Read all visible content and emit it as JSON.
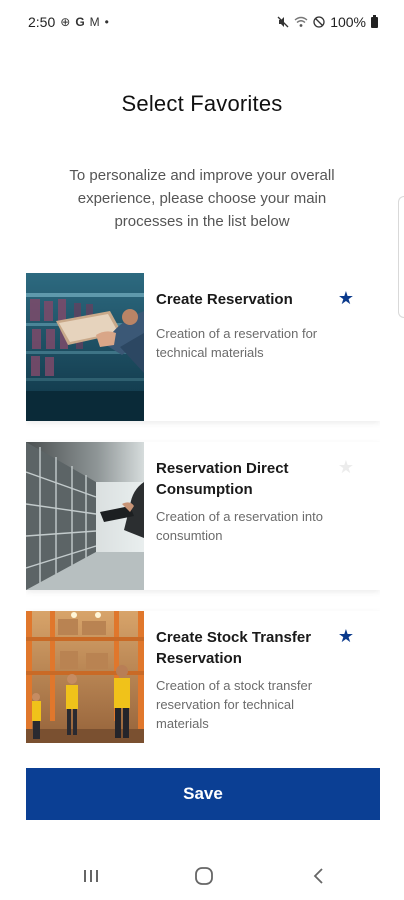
{
  "status_bar": {
    "time": "2:50",
    "battery": "100%"
  },
  "header": {
    "title": "Select Favorites"
  },
  "intro": {
    "text": "To personalize and improve your overall experience, please choose your main processes in the list below"
  },
  "processes": [
    {
      "title": "Create Reservation",
      "description": "Creation of a reservation for technical materials",
      "favorite": true,
      "image": "warehouse-tablet-photo"
    },
    {
      "title": "Reservation Direct Consumption",
      "description": "Creation of a reservation into consumtion",
      "favorite": false,
      "image": "warehouse-aisle-photo"
    },
    {
      "title": "Create Stock Transfer Reservation",
      "description": "Creation of a stock transfer reservation for technical materials",
      "favorite": true,
      "image": "warehouse-workers-photo"
    }
  ],
  "actions": {
    "save_label": "Save"
  },
  "colors": {
    "primary": "#0b3f94",
    "star_active": "#0b3a8c",
    "star_inactive": "#ececec"
  },
  "icons": {
    "star_filled": "★",
    "nav_recent": "recent-apps-icon",
    "nav_home": "home-icon",
    "nav_back": "back-icon"
  }
}
